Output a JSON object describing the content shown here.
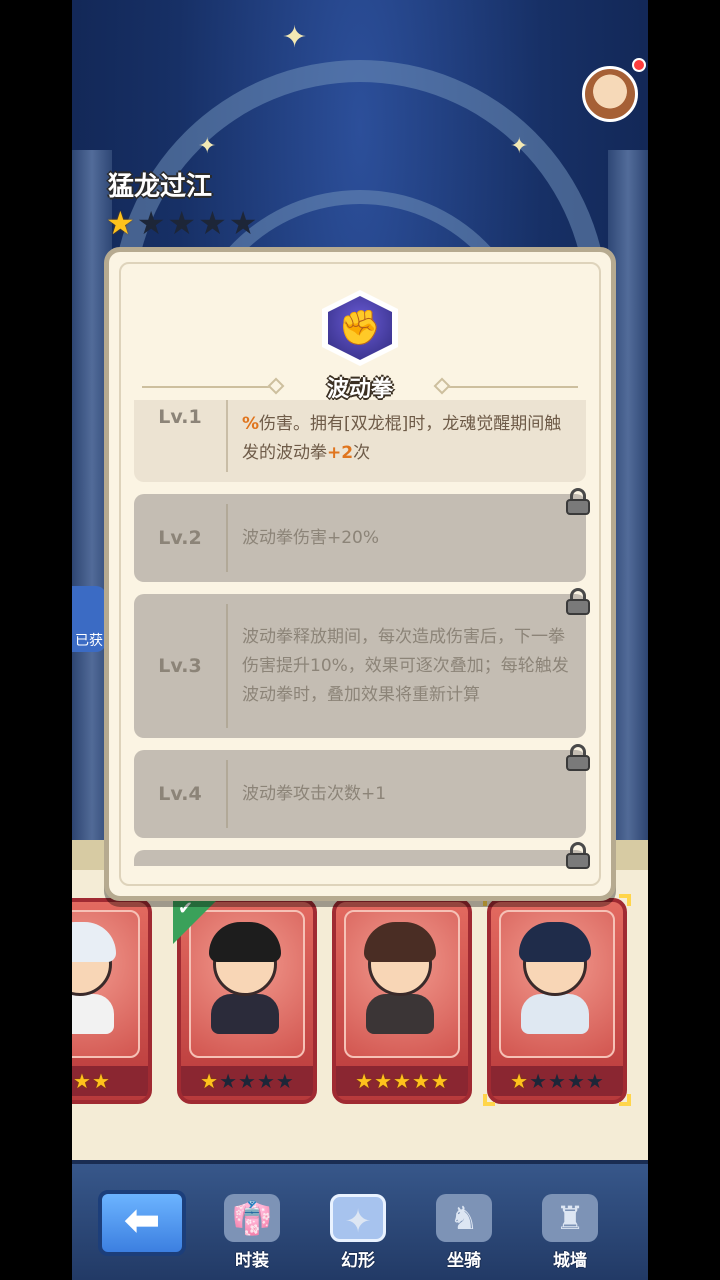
{
  "hero": {
    "name": "猛龙过江",
    "stars_filled": 1,
    "stars_total": 5
  },
  "left_tab": {
    "label": "已获"
  },
  "skill": {
    "name": "波动拳"
  },
  "levels": [
    {
      "label": "Lv.1",
      "unlocked": true,
      "desc_parts": [
        {
          "text": "%",
          "hl": true
        },
        {
          "text": "伤害。拥有[双龙棍]时，龙魂觉醒期间触发的波动拳",
          "hl": false
        },
        {
          "text": "+2",
          "hl": true
        },
        {
          "text": "次",
          "hl": false
        }
      ]
    },
    {
      "label": "Lv.2",
      "unlocked": false,
      "desc": "波动拳伤害+20%"
    },
    {
      "label": "Lv.3",
      "unlocked": false,
      "desc": "波动拳释放期间，每次造成伤害后，下一拳伤害提升10%，效果可逐次叠加；每轮触发波动拳时，叠加效果将重新计算"
    },
    {
      "label": "Lv.4",
      "unlocked": false,
      "desc": "波动拳攻击次数+1"
    }
  ],
  "cards": [
    {
      "stars_filled": 3,
      "stars_total": 3,
      "hair": "#e8eef5",
      "body": "#f2f2f2"
    },
    {
      "stars_filled": 1,
      "stars_total": 5,
      "hair": "#1d1d1d",
      "body": "#2b2b3a",
      "owned": true
    },
    {
      "stars_filled": 5,
      "stars_total": 5,
      "hair": "#4a2d24",
      "body": "#3b3536"
    },
    {
      "stars_filled": 1,
      "stars_total": 5,
      "hair": "#1f2c4a",
      "body": "#dfe8f2",
      "selected": true
    }
  ],
  "nav": {
    "back": "⬅",
    "items": [
      {
        "label": "时装",
        "icon": "outfit-icon",
        "glyph": "👘"
      },
      {
        "label": "幻形",
        "icon": "transform-icon",
        "glyph": "✦",
        "active": true
      },
      {
        "label": "坐骑",
        "icon": "mount-icon",
        "glyph": "♞"
      },
      {
        "label": "城墙",
        "icon": "castle-wall-icon",
        "glyph": "♜"
      }
    ]
  }
}
